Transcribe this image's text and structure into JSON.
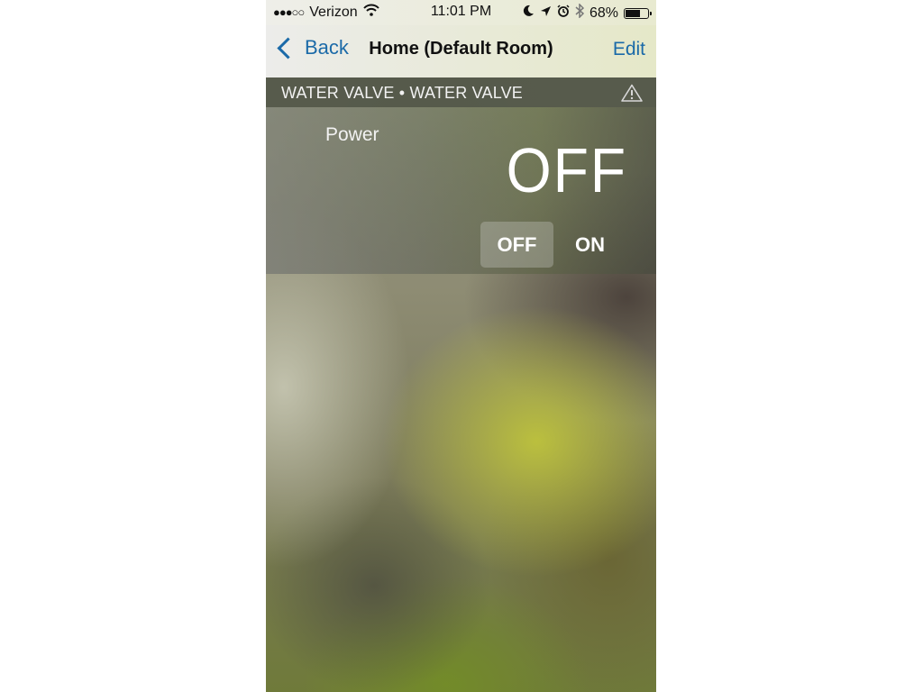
{
  "status_bar": {
    "signal": "●●●○○",
    "carrier": "Verizon",
    "time": "11:01 PM",
    "battery_percent": "68%",
    "battery_level": 0.68
  },
  "nav": {
    "back_label": "Back",
    "title": "Home (Default Room)",
    "edit_label": "Edit"
  },
  "device": {
    "label": "WATER VALVE • WATER VALVE"
  },
  "power": {
    "label": "Power",
    "value": "OFF",
    "options": [
      "OFF",
      "ON"
    ],
    "selected": "OFF"
  }
}
